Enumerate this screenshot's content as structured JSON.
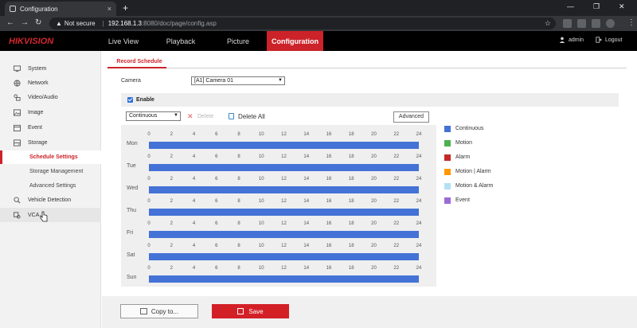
{
  "browser": {
    "tab_title": "Configuration",
    "tab_close": "×",
    "new_tab": "+",
    "not_secure": "Not secure",
    "url_host": "192.168.1.3",
    "url_path": ":8080/doc/page/config.asp",
    "win_min": "—",
    "win_max": "❐",
    "win_close": "✕"
  },
  "app": {
    "logo": "HIKVISION",
    "nav": [
      "Live View",
      "Playback",
      "Picture",
      "Configuration"
    ],
    "user": "admin",
    "logout": "Logout"
  },
  "sidebar": {
    "items": [
      "System",
      "Network",
      "Video/Audio",
      "Image",
      "Event",
      "Storage"
    ],
    "storage_sub": [
      "Schedule Settings",
      "Storage Management",
      "Advanced Settings"
    ],
    "after": [
      "Vehicle Detection",
      "VCA"
    ]
  },
  "content": {
    "tab": "Record Schedule",
    "camera_label": "Camera",
    "camera_value": "[A1] Camera 01",
    "enable_label": "Enable",
    "mode_value": "Continuous",
    "delete_label": "Delete",
    "delete_all_label": "Delete All",
    "advanced_label": "Advanced",
    "copy_label": "Copy to...",
    "save_label": "Save"
  },
  "schedule": {
    "days": [
      "Mon",
      "Tue",
      "Wed",
      "Thu",
      "Fri",
      "Sat",
      "Sun"
    ],
    "hours": [
      "0",
      "2",
      "4",
      "6",
      "8",
      "10",
      "12",
      "14",
      "16",
      "18",
      "20",
      "22",
      "24"
    ],
    "bar_color": "#4472d6",
    "coverage": "0-24 every day"
  },
  "legend": [
    {
      "label": "Continuous",
      "color": "#4472d6"
    },
    {
      "label": "Motion",
      "color": "#4caf50"
    },
    {
      "label": "Alarm",
      "color": "#c62828"
    },
    {
      "label": "Motion | Alarm",
      "color": "#ff9800"
    },
    {
      "label": "Motion & Alarm",
      "color": "#b3e0f2"
    },
    {
      "label": "Event",
      "color": "#9c6ad6"
    }
  ]
}
